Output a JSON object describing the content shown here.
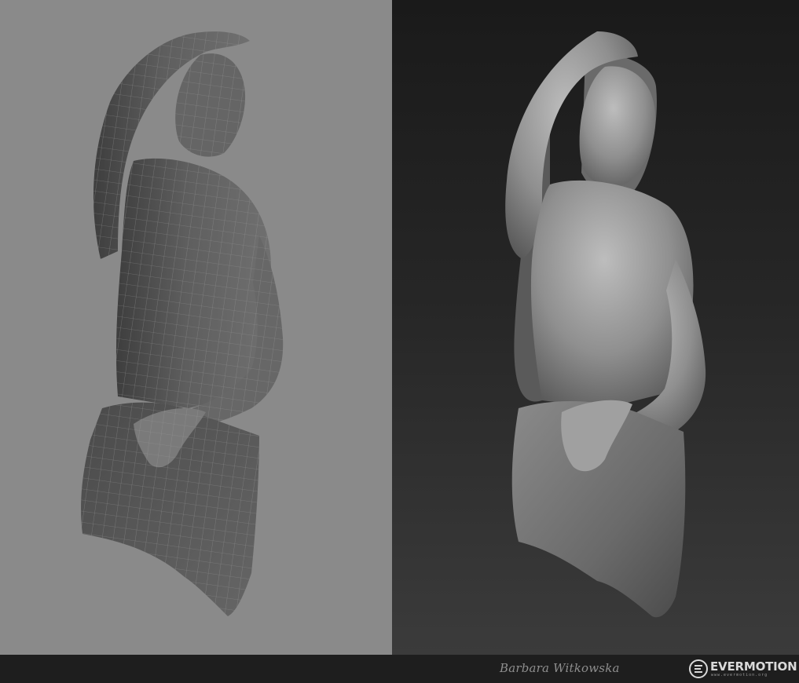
{
  "panels": {
    "left": {
      "kind": "wireframe low-poly base mesh"
    },
    "right": {
      "kind": "sculpted high-poly render"
    }
  },
  "credits": {
    "author": "Barbara Witkowska",
    "brand_name": "EVERMOTION",
    "brand_tagline": "www.evermotion.org"
  },
  "colors": {
    "left_background": "#8a8a8a",
    "right_background": "#262626",
    "footer_background": "#1e1e1e"
  }
}
